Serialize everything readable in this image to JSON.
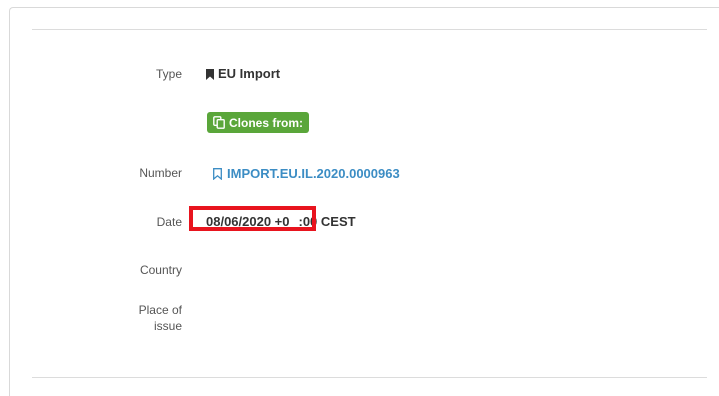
{
  "fields": {
    "type": {
      "label": "Type",
      "value": "EU Import"
    },
    "clones_badge": {
      "label": "Clones from:"
    },
    "number": {
      "label": "Number",
      "value": "IMPORT.EU.IL.2020.0000963"
    },
    "date": {
      "label": "Date",
      "value_part1": "08/06/2020 +0",
      "value_part2": ":00 CEST"
    },
    "country": {
      "label": "Country",
      "value": ""
    },
    "place_of_issue": {
      "label_line1": "Place of",
      "label_line2": "issue",
      "value": ""
    }
  },
  "colors": {
    "link": "#3c8dc4",
    "badge_green": "#5aa63a",
    "highlight_red": "#e8141e"
  },
  "icons": {
    "type_icon": "bookmark-solid-icon",
    "clones_icon": "clone-copy-icon",
    "number_icon": "bookmark-outline-icon"
  }
}
